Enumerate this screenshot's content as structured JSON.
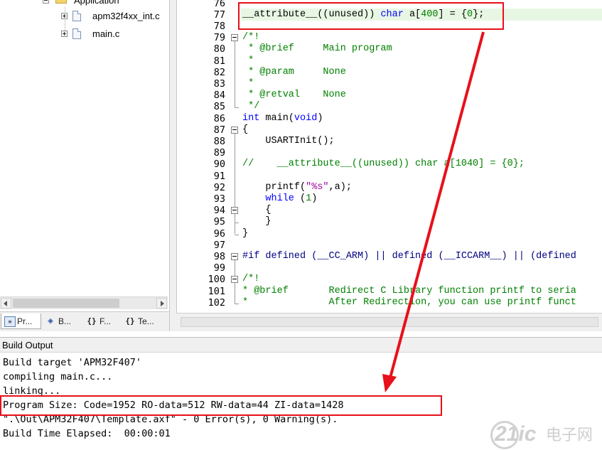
{
  "project_tree": {
    "group_label": "Application",
    "files": [
      {
        "name": "apm32f4xx_int.c"
      },
      {
        "name": "main.c"
      }
    ]
  },
  "pane_tabs": [
    {
      "label": "Pr...",
      "icon": "project-icon",
      "active": true
    },
    {
      "label": "B...",
      "icon": "books-icon",
      "active": false
    },
    {
      "label": "F...",
      "icon": "functions-icon",
      "active": false
    },
    {
      "label": "Te...",
      "icon": "templates-icon",
      "active": false
    }
  ],
  "editor": {
    "lines": [
      {
        "num": "76",
        "text": ""
      },
      {
        "num": "77",
        "text": "__attribute__((unused)) char a[400] = {0};"
      },
      {
        "num": "78",
        "text": ""
      },
      {
        "num": "79",
        "text": "/*!"
      },
      {
        "num": "80",
        "text": " * @brief     Main program"
      },
      {
        "num": "81",
        "text": " *"
      },
      {
        "num": "82",
        "text": " * @param     None"
      },
      {
        "num": "83",
        "text": " *"
      },
      {
        "num": "84",
        "text": " * @retval    None"
      },
      {
        "num": "85",
        "text": " */"
      },
      {
        "num": "86",
        "text": "int main(void)"
      },
      {
        "num": "87",
        "text": "{"
      },
      {
        "num": "88",
        "text": "    USARTInit();"
      },
      {
        "num": "89",
        "text": "    "
      },
      {
        "num": "90",
        "text": "//    __attribute__((unused)) char a[1040] = {0};"
      },
      {
        "num": "91",
        "text": ""
      },
      {
        "num": "92",
        "text": "    printf(\"%s\",a);"
      },
      {
        "num": "93",
        "text": "    while (1)"
      },
      {
        "num": "94",
        "text": "    {"
      },
      {
        "num": "95",
        "text": "    }"
      },
      {
        "num": "96",
        "text": "}"
      },
      {
        "num": "97",
        "text": ""
      },
      {
        "num": "98",
        "text": "#if defined (__CC_ARM) || defined (__ICCARM__) || (defined"
      },
      {
        "num": "99",
        "text": ""
      },
      {
        "num": "100",
        "text": "/*!"
      },
      {
        "num": "101",
        "text": "* @brief       Redirect C Library function printf to seria"
      },
      {
        "num": "102",
        "text": "*              After Redirection, you can use printf funct"
      }
    ]
  },
  "build_output": {
    "title": "Build Output",
    "lines": [
      "Build target 'APM32F407'",
      "compiling main.c...",
      "linking...",
      "Program Size: Code=1952 RO-data=512 RW-data=44 ZI-data=1428",
      "\".\\Out\\APM32F407\\Template.axf\" - 0 Error(s), 0 Warning(s).",
      "Build Time Elapsed:  00:00:01"
    ]
  },
  "watermark": {
    "text": "21ic",
    "cn_text": "电子网"
  },
  "colors": {
    "annotation_red": "#e8101a",
    "keyword_blue": "#0000ff",
    "comment_green": "#008000",
    "current_line": "#e8f7e4"
  }
}
